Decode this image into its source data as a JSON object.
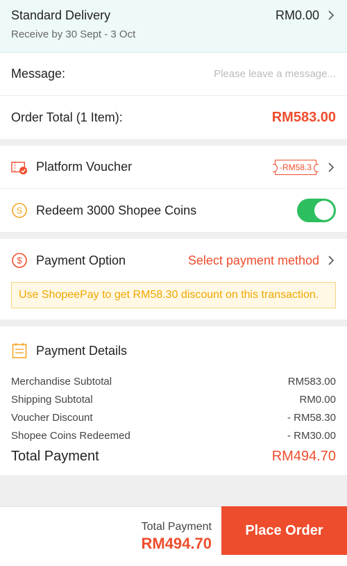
{
  "delivery": {
    "title": "Standard Delivery",
    "eta": "Receive by 30 Sept - 3 Oct",
    "price": "RM0.00"
  },
  "message": {
    "label": "Message:",
    "placeholder": "Please leave a message..."
  },
  "order_total": {
    "label": "Order Total (1 Item):",
    "amount": "RM583.00"
  },
  "voucher": {
    "label": "Platform Voucher",
    "tag": "-RM58.3"
  },
  "coins": {
    "label": "Redeem 3000 Shopee Coins",
    "enabled": true
  },
  "payment_option": {
    "label": "Payment Option",
    "value": "Select payment method"
  },
  "promo": {
    "text": "Use ShopeePay to get RM58.30 discount on this transaction."
  },
  "payment_details": {
    "title": "Payment Details",
    "rows": [
      {
        "label": "Merchandise Subtotal",
        "value": "RM583.00"
      },
      {
        "label": "Shipping Subtotal",
        "value": "RM0.00"
      },
      {
        "label": "Voucher Discount",
        "value": "- RM58.30"
      },
      {
        "label": "Shopee Coins Redeemed",
        "value": "- RM30.00"
      }
    ],
    "total_label": "Total Payment",
    "total_value": "RM494.70"
  },
  "footer": {
    "total_label": "Total Payment",
    "total_value": "RM494.70",
    "place_order": "Place Order"
  },
  "colors": {
    "accent": "#ee4d2d",
    "toggle_on": "#2dbe60",
    "promo_text": "#f0a800",
    "delivery_bg": "#eefaf9"
  }
}
